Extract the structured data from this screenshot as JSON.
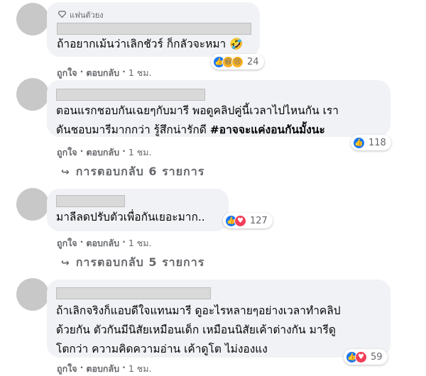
{
  "comments": [
    {
      "badge": "แฟนตัวยง",
      "lines": [
        "ถ้าอยากเม้นว่าเลิกชัวร์ ก็กลัวจะหมา 🤣"
      ],
      "reactions": [
        "like",
        "haha",
        "sad"
      ],
      "reaction_count": "24",
      "actions": {
        "like": "ถูกใจ",
        "dot1": "·",
        "reply": "ตอบกลับ",
        "dot2": "·",
        "time": "1 ชม."
      }
    },
    {
      "lines": [
        "ตอนแรกชอบกันเฉยๆกับมารี พอดูคลิปคู่นี้เวลาไปไหนกัน เรา",
        "ดันชอบมารีมากกว่า รู้สึกน่ารักดี "
      ],
      "hashtag": "#อาจจะแค่งอนกันมั้งนะ",
      "reactions": [
        "like"
      ],
      "reaction_count": "118",
      "actions": {
        "like": "ถูกใจ",
        "dot1": "·",
        "reply": "ตอบกลับ",
        "dot2": "·",
        "time": "1 ชม."
      },
      "replies": {
        "icon": "↪",
        "label": "การตอบกลับ 6 รายการ"
      }
    },
    {
      "lines": [
        "มาลีลดปรับตัวเพื่อกันเยอะมาก.."
      ],
      "reactions": [
        "like",
        "love"
      ],
      "reaction_count": "127",
      "actions": {
        "like": "ถูกใจ",
        "dot1": "·",
        "reply": "ตอบกลับ",
        "dot2": "·",
        "time": "1 ชม."
      },
      "replies": {
        "icon": "↪",
        "label": "การตอบกลับ 5 รายการ"
      }
    },
    {
      "lines": [
        "ถ้าเลิกจริงก็แอบดีใจแทนมารี ดูอะไรหลายๆอย่างเวลาทำคลิป",
        "ด้วยกัน ตัวกันมีนิสัยเหมือนเด็ก เหมือนนิสัยเค้าต่างกัน มารีดู",
        "โตกว่า ความคิดความอ่าน เค้าดูโต ไม่งองแง"
      ],
      "reactions": [
        "like",
        "love"
      ],
      "reaction_count": "59",
      "actions": {
        "like": "ถูกใจ",
        "dot1": "·",
        "reply": "ตอบกลับ",
        "dot2": "·",
        "time": "1 ชม."
      }
    }
  ],
  "colors": {
    "bubble": "#f0f2f5",
    "muted": "#65676b",
    "like": "#1877f2",
    "love": "#f33e58",
    "haha": "#f7b125"
  }
}
